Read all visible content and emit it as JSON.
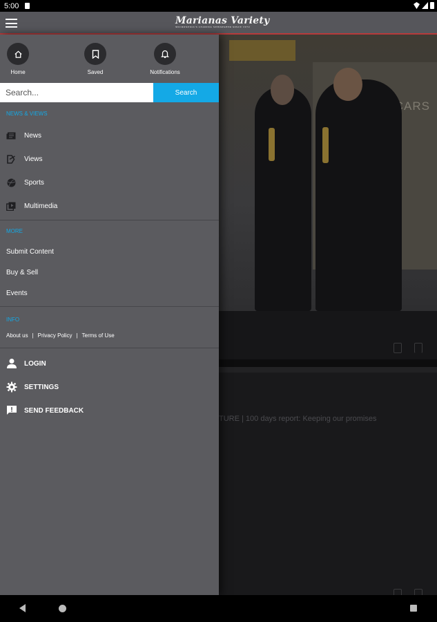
{
  "status": {
    "time": "5:00"
  },
  "app": {
    "logo_text": "Marianas Variety",
    "logo_subtitle": "MICRONESIA'S LEADING NEWSPAPER SINCE 1972"
  },
  "quick": {
    "home_label": "Home",
    "saved_label": "Saved",
    "notifications_label": "Notifications"
  },
  "search": {
    "placeholder": "Search...",
    "button_label": "Search"
  },
  "news_views": {
    "title": "NEWS & VIEWS",
    "items": [
      {
        "label": "News",
        "icon": "newspaper-icon"
      },
      {
        "label": "Views",
        "icon": "views-icon"
      },
      {
        "label": "Sports",
        "icon": "sports-icon"
      },
      {
        "label": "Multimedia",
        "icon": "multimedia-icon"
      }
    ]
  },
  "more": {
    "title": "MORE",
    "items": [
      "Submit Content",
      "Buy & Sell",
      "Events"
    ]
  },
  "info": {
    "title": "INFO",
    "links": [
      "About us",
      "Privacy Policy",
      "Terms of Use"
    ],
    "separator": "|"
  },
  "account": {
    "login_label": "LOGIN",
    "settings_label": "SETTINGS",
    "feedback_label": "SEND FEEDBACK"
  },
  "background": {
    "photo_text": "SCARS",
    "headline": "TURE | 100 days report: Keeping our promises"
  },
  "colors": {
    "accent": "#14a9e6",
    "drawer": "#5b5b5f",
    "appbar": "#56565b"
  }
}
